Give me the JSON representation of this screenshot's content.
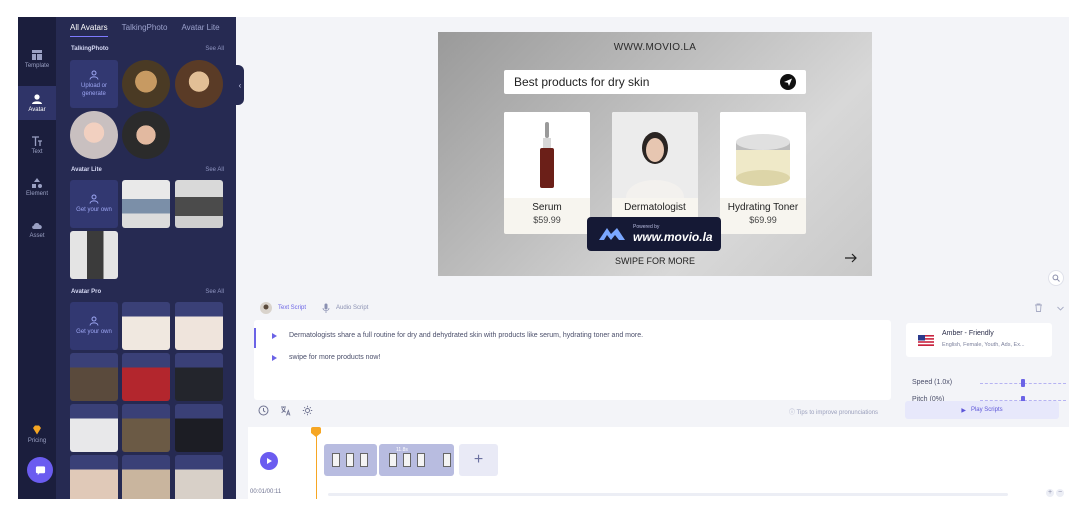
{
  "rail": {
    "items": [
      {
        "label": "Template",
        "icon": "template-icon"
      },
      {
        "label": "Avatar",
        "icon": "avatar-icon"
      },
      {
        "label": "Text",
        "icon": "text-icon"
      },
      {
        "label": "Element",
        "icon": "element-icon"
      },
      {
        "label": "Asset",
        "icon": "cloud-icon"
      }
    ],
    "pricing": "Pricing"
  },
  "panel": {
    "tabs": [
      "All Avatars",
      "TalkingPhoto",
      "Avatar Lite"
    ],
    "talking_photo": {
      "title": "TalkingPhoto",
      "see_all": "See All",
      "upload_label": "Upload or generate"
    },
    "avatar_lite": {
      "title": "Avatar Lite",
      "see_all": "See All",
      "get_own": "Get your own"
    },
    "avatar_pro": {
      "title": "Avatar Pro",
      "see_all": "See All",
      "get_own": "Get your own"
    }
  },
  "canvas": {
    "url": "WWW.MOVIO.LA",
    "search": "Best products for dry skin",
    "products": [
      {
        "name": "Serum",
        "price": "$59.99"
      },
      {
        "name": "Dermatologist",
        "price": ""
      },
      {
        "name": "Hydrating Toner",
        "price": "$69.99"
      }
    ],
    "swipe": "SWIPE FOR MORE",
    "badge_powered": "Powered by",
    "badge_url": "www.movio.la"
  },
  "script": {
    "tabs": [
      "Text Script",
      "Audio Script"
    ],
    "lines": [
      "Dermatologists share a full routine for dry and dehydrated skin with products like serum, hydrating toner and more.",
      "swipe for more products now!"
    ],
    "tips": "Tips to improve pronunciations",
    "play_button": "Play Scripts"
  },
  "voice": {
    "name": "Amber - Friendly",
    "tags": "English, Female, Youth, Ads, Ex...",
    "speed_label": "Speed (1.0x)",
    "pitch_label": "Pitch (0%)",
    "speed_value": 0.5,
    "pitch_value": 0.5
  },
  "timeline": {
    "time": "00:01/00:11",
    "clip_duration": "11.8s",
    "add_label": "+"
  },
  "colors": {
    "accent": "#6b63e6",
    "panel": "#262a52",
    "rail": "#1b1e3d",
    "playhead": "#f6a623"
  }
}
